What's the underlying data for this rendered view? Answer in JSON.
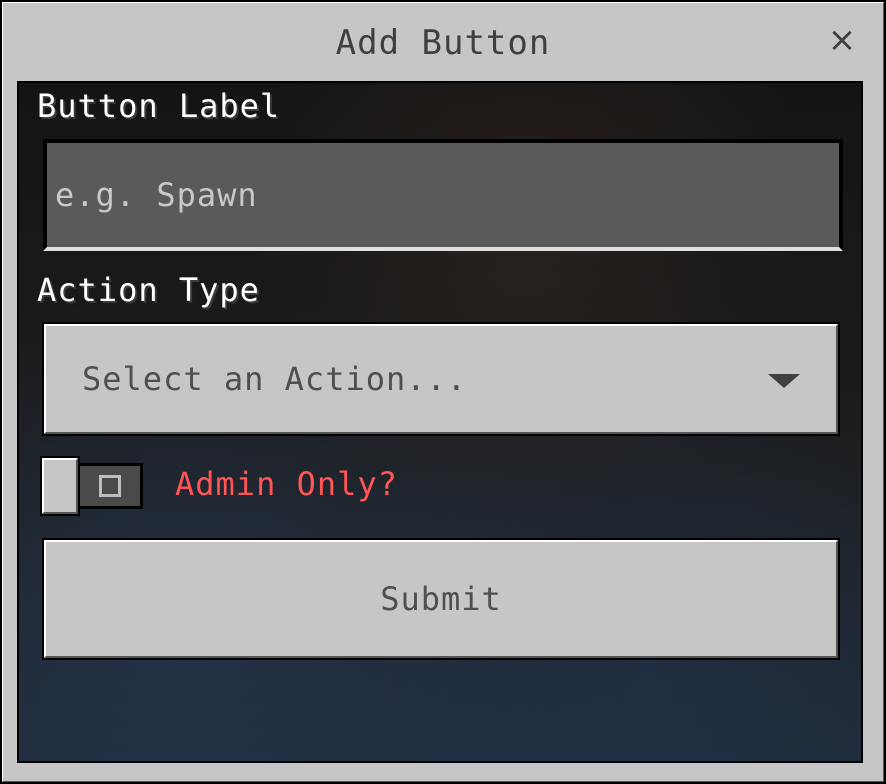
{
  "dialog": {
    "title": "Add Button",
    "close_symbol": "×"
  },
  "fields": {
    "button_label": {
      "label": "Button Label",
      "placeholder": "e.g. Spawn",
      "value": ""
    },
    "action_type": {
      "label": "Action Type",
      "selected": "Select an Action..."
    },
    "admin_only": {
      "label": "Admin Only?",
      "state": "off",
      "off_symbol": "O"
    }
  },
  "actions": {
    "submit_label": "Submit"
  },
  "icons": {
    "close": "close-icon",
    "dropdown": "chevron-down-icon"
  },
  "colors": {
    "panel": "#c6c6c6",
    "input_bg": "#5a5a5a",
    "admin_label": "#ff5555",
    "text_dark": "#3f3f3f"
  }
}
